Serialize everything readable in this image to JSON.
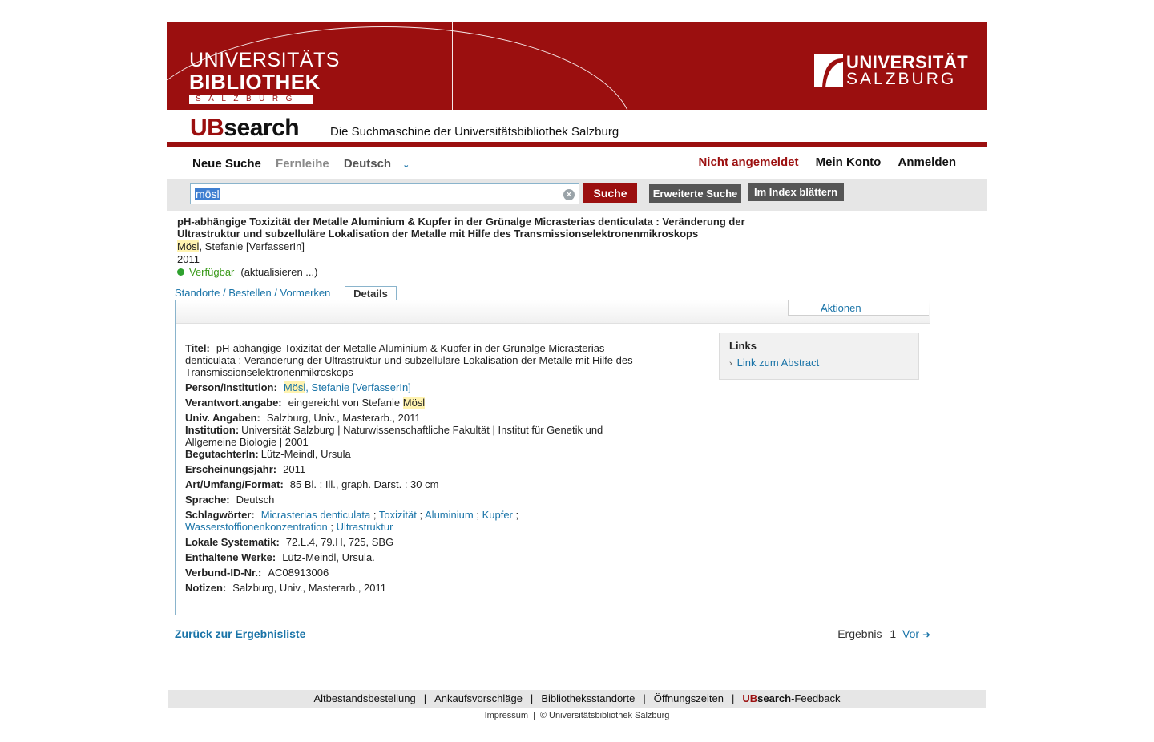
{
  "banner": {
    "ub_line1": "UNIVERSITÄTS",
    "ub_line2": "BIBLIOTHEK",
    "ub_line3": "SALZBURG",
    "us_line1": "UNIVERSITÄT",
    "us_line2": "SALZBURG",
    "brand_color": "#9b0f0f"
  },
  "ubsearch": {
    "brand_ub": "UB",
    "brand_search": "search",
    "tagline": "Die Suchmaschine der Universitätsbibliothek Salzburg"
  },
  "nav": {
    "new_search": "Neue Suche",
    "fernleihe": "Fernleihe",
    "language": "Deutsch",
    "status": "Nicht angemeldet",
    "account": "Mein Konto",
    "login": "Anmelden"
  },
  "search": {
    "value": "mösl",
    "submit": "Suche",
    "advanced": "Erweiterte Suche",
    "browse": "Im Index blättern"
  },
  "record": {
    "title": "pH-abhängige Toxizität der Metalle Aluminium & Kupfer in der Grünalge Micrasterias denticulata : Veränderung der Ultrastruktur und subzelluläre Lokalisation der Metalle mit Hilfe des Transmissionselektronenmikroskops",
    "author_hl": "Mösl",
    "author_rest": ", Stefanie [VerfasserIn]",
    "year": "2011",
    "availability": "Verfügbar",
    "refresh": "(aktualisieren ...)"
  },
  "tabs": {
    "locations": "Standorte / Bestellen / Vormerken",
    "details": "Details"
  },
  "actions": "Aktionen",
  "details": {
    "titel_label": "Titel:",
    "titel_value": "pH-abhängige Toxizität der Metalle Aluminium & Kupfer in der Grünalge Micrasterias denticulata : Veränderung der Ultrastruktur und subzelluläre Lokalisation der Metalle mit Hilfe des Transmissionselektronenmikroskops",
    "person_label": "Person/Institution:",
    "person_hl": "Mösl",
    "person_rest": ", Stefanie [VerfasserIn]",
    "verantw_label": "Verantwort.angabe:",
    "verantw_value": "eingereicht von Stefanie ",
    "verantw_hl": "Mösl",
    "univ_label": "Univ. Angaben:",
    "univ_value": "Salzburg, Univ., Masterarb., 2011",
    "inst_label": "Institution:",
    "inst_value": "Universität Salzburg | Naturwissenschaftliche Fakultät | Institut für Genetik und Allgemeine Biologie | 2001",
    "begut_label": "BegutachterIn:",
    "begut_value": "Lütz-Meindl, Ursula",
    "jahr_label": "Erscheinungsjahr:",
    "jahr_value": "2011",
    "art_label": "Art/Umfang/Format:",
    "art_value": "85 Bl. : Ill., graph. Darst. : 30 cm",
    "sprache_label": "Sprache:",
    "sprache_value": "Deutsch",
    "schlag_label": "Schlagwörter:",
    "schlag_items": [
      "Micrasterias denticulata",
      "Toxizität",
      "Aluminium",
      "Kupfer",
      "Wasserstoffionenkonzentration",
      "Ultrastruktur"
    ],
    "schlag_sep": ";",
    "syst_label": "Lokale Systematik:",
    "syst_value": "72.L.4, 79.H, 725, SBG",
    "werke_label": "Enthaltene Werke:",
    "werke_value": "Lütz-Meindl, Ursula.",
    "verbund_label": "Verbund-ID-Nr.:",
    "verbund_value": "AC08913006",
    "notizen_label": "Notizen:",
    "notizen_value": "Salzburg, Univ., Masterarb., 2011"
  },
  "links": {
    "heading": "Links",
    "abstract": "Link zum Abstract"
  },
  "pager": {
    "back": "Zurück zur Ergebnisliste",
    "label": "Ergebnis",
    "number": "1",
    "next": "Vor"
  },
  "footer": {
    "items": [
      "Altbestandsbestellung",
      "Ankaufsvorschläge",
      "Bibliotheksstandorte",
      "Öffnungszeiten"
    ],
    "sep": "|",
    "feedback_ub": "UB",
    "feedback_search": "search",
    "feedback_rest": "-Feedback",
    "impressum": "Impressum",
    "copyright": "© Universitätsbibliothek Salzburg"
  }
}
